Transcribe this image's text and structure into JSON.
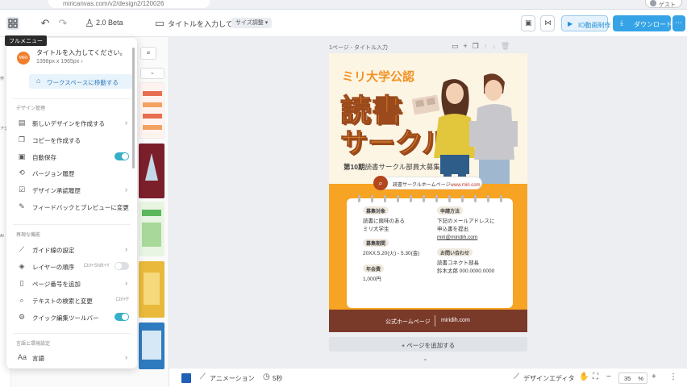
{
  "browser": {
    "url": "miricanvas.com/v2/design2/120026",
    "profile_label": "ゲスト"
  },
  "toolbar": {
    "version": "2.0 Beta",
    "title_placeholder": "タイトルを入力してくだ",
    "resize_label": "サイズ調整",
    "video_button": "IO動画制作",
    "download_button": "ダウンロード"
  },
  "tooltip": "フルメニュー",
  "rail_labels": [
    "作",
    "アク",
    "AI"
  ],
  "menu": {
    "avatar": "MIRI",
    "doc_title": "タイトルを入力してください。",
    "doc_size": "1398px x 1965px",
    "workspace_button": "ワークスペースに移動する",
    "section_design": "デザイン管理",
    "items_design": [
      {
        "label": "新しいデザインを作成する",
        "icon": "file-plus-icon",
        "arrow": true
      },
      {
        "label": "コピーを作成する",
        "icon": "copy-icon",
        "arrow": false
      },
      {
        "label": "自動保存",
        "icon": "save-icon",
        "toggle": true
      },
      {
        "label": "バージョン履歴",
        "icon": "history-icon",
        "arrow": false
      },
      {
        "label": "デザイン承認履歴",
        "icon": "approval-icon",
        "arrow": true
      },
      {
        "label": "フィードバックとプレビューに変更",
        "icon": "feedback-icon",
        "arrow": true
      }
    ],
    "section_features": "再現な機能",
    "items_features": [
      {
        "label": "ガイド線の設定",
        "icon": "guide-icon",
        "arrow": true
      },
      {
        "label": "レイヤーの順序",
        "icon": "layers-icon",
        "shortcut": "Ctrl+Shift+Y",
        "toggle": false
      },
      {
        "label": "ページ番号を追加",
        "icon": "page-number-icon",
        "arrow": true
      },
      {
        "label": "テキストの検索と変更",
        "icon": "search-icon",
        "shortcut": "Ctrl+F"
      },
      {
        "label": "クイック編集ツールバー",
        "icon": "gear-icon",
        "toggle": true
      }
    ],
    "section_env": "言語と環境設定",
    "items_env": [
      {
        "label": "言語",
        "icon": "language-icon",
        "arrow": true
      }
    ]
  },
  "canvas": {
    "page_label": "1ページ - タイトル入力",
    "add_page": "+ ページを追加する"
  },
  "poster": {
    "university": "ミリ大学公認",
    "big_line1": "読書",
    "big_line2": "サークル",
    "sub_bold": "第10期",
    "sub_rest": "読書サークル部員大募集",
    "search_text": "読書サークルホームページ",
    "search_url": "www.miri.com",
    "blocks": [
      {
        "tag": "募集対象",
        "lines": [
          "読書に興味のある",
          "ミリ大学生"
        ]
      },
      {
        "tag": "募集期間",
        "lines": [
          "20XX.5.20(火) - 5.30(金)"
        ]
      },
      {
        "tag": "年会費",
        "lines": [
          "1,000円"
        ]
      },
      {
        "tag": "申請方法",
        "lines": [
          "下記のメールアドレスに",
          "申込書を提出"
        ]
      },
      {
        "link": "miri@miridih.com"
      },
      {
        "tag": "お問い合わせ",
        "lines": [
          "読書コネクト部長",
          "鈴木太郎 000.0000.0000"
        ]
      }
    ],
    "footer_left": "公式ホームページ",
    "footer_right": "miridih.com",
    "colors": {
      "orange": "#f7a323",
      "brown": "#7a3a2a",
      "cream": "#fdf5e4"
    }
  },
  "bottombar": {
    "animation": "アニメーション",
    "duration": "5秒",
    "editor": "デザインエディタ",
    "zoom": "35",
    "zoom_unit": "%"
  }
}
